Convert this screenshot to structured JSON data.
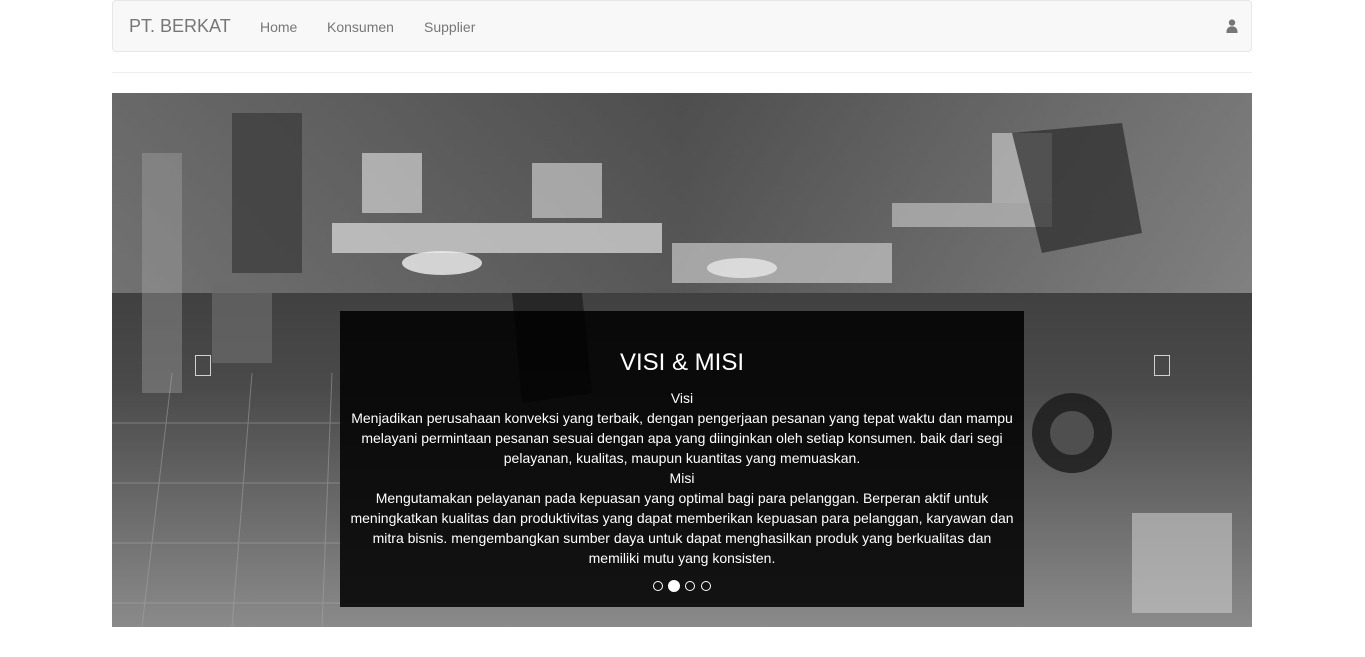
{
  "navbar": {
    "brand": "PT. BERKAT",
    "links": [
      "Home",
      "Konsumen",
      "Supplier"
    ],
    "user_icon": "user-icon"
  },
  "carousel": {
    "title": "VISI & MISI",
    "visi_heading": "Visi",
    "visi_text": "Menjadikan perusahaan konveksi yang terbaik, dengan pengerjaan pesanan yang tepat waktu dan mampu melayani permintaan pesanan sesuai dengan apa yang diinginkan oleh setiap konsumen. baik dari segi pelayanan, kualitas, maupun kuantitas yang memuaskan.",
    "misi_heading": "Misi",
    "misi_text": "Mengutamakan pelayanan pada kepuasan yang optimal bagi para pelanggan. Berperan aktif untuk meningkatkan kualitas dan produktivitas yang dapat memberikan kepuasan para pelanggan, karyawan dan mitra bisnis. mengembangkan sumber daya untuk dapat menghasilkan produk yang berkualitas dan memiliki mutu yang konsisten.",
    "slide_count": 4,
    "active_slide": 2,
    "prev_icon": "chevron-left-icon",
    "next_icon": "chevron-right-icon",
    "background_image": "grayscale garment workshop photo with sewing machines"
  },
  "colors": {
    "navbar_bg": "#f8f8f8",
    "navbar_border": "#e7e7e7",
    "nav_text": "#777777",
    "caption_bg": "#000000",
    "caption_text": "#ffffff"
  }
}
